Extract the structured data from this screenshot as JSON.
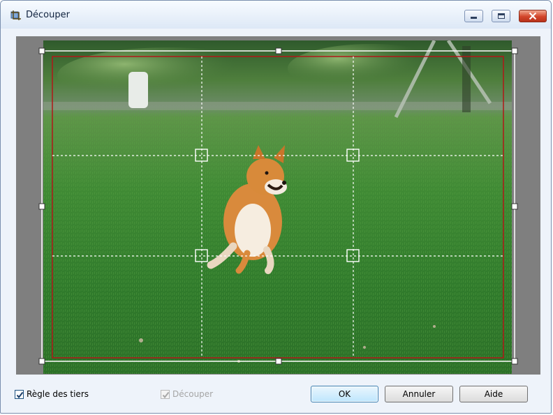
{
  "window": {
    "title": "Découper",
    "icons": {
      "app": "crop-icon",
      "minimize": "minimize-icon",
      "maximize": "maximize-icon",
      "close": "close-icon"
    }
  },
  "crop": {
    "image": "shiba-dog-on-grass-photo",
    "rule_of_thirds_visible": true
  },
  "footer": {
    "rule_of_thirds_label": "Règle des tiers",
    "rule_of_thirds_checked": true,
    "crop_label": "Découper",
    "crop_checked": true,
    "crop_enabled": false,
    "ok_label": "OK",
    "cancel_label": "Annuler",
    "help_label": "Aide"
  },
  "colors": {
    "crop_border": "#ffffff",
    "safe_area": "#b01818",
    "title_bar": "#dde8f6",
    "close_button": "#d2452a"
  }
}
